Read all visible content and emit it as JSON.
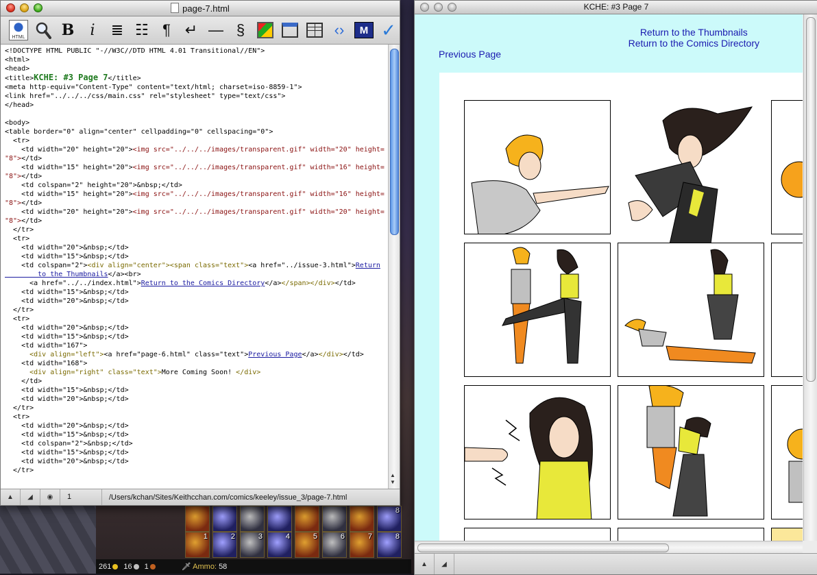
{
  "editor": {
    "title": "page-7.html",
    "toolbar_icons": [
      "html-doc-icon",
      "magnify-icon",
      "bold-icon",
      "italic-icon",
      "align-icon",
      "list-icon",
      "paragraph-icon",
      "line-break-icon",
      "hr-icon",
      "link-icon",
      "image-icon",
      "frame-icon",
      "table-icon",
      "tag-icon",
      "mark-icon",
      "check-icon"
    ],
    "toolbar_glyphs": {
      "bold": "B",
      "italic": "i",
      "align": "≣",
      "list": "☷",
      "paragraph": "¶",
      "linebreak": "↵",
      "hr": "—",
      "link": "§",
      "tag": "‹›",
      "check": "✓",
      "mark": "M"
    },
    "status_line": "1",
    "status_path": "/Users/kchan/Sites/Keithcchan.com/comics/keeley/issue_3/page-7.html"
  },
  "browser": {
    "title": "KCHE: #3 Page 7",
    "return_thumbnails": "Return to the Thumbnails",
    "return_directory": "Return to the Comics Directory",
    "previous_page": "Previous Page"
  },
  "game": {
    "hotbar_top": [
      "",
      "",
      "",
      "",
      "",
      "",
      "",
      "8"
    ],
    "hotbar_bottom": [
      "1",
      "2",
      "3",
      "4",
      "5",
      "6",
      "7",
      "8"
    ],
    "gold": "261",
    "silver": "16",
    "copper": "1",
    "ammo_label": "Ammo:",
    "ammo_count": "58",
    "colors": {
      "gold": "#e8c020",
      "silver": "#c0c0c0",
      "copper": "#c06020"
    }
  }
}
